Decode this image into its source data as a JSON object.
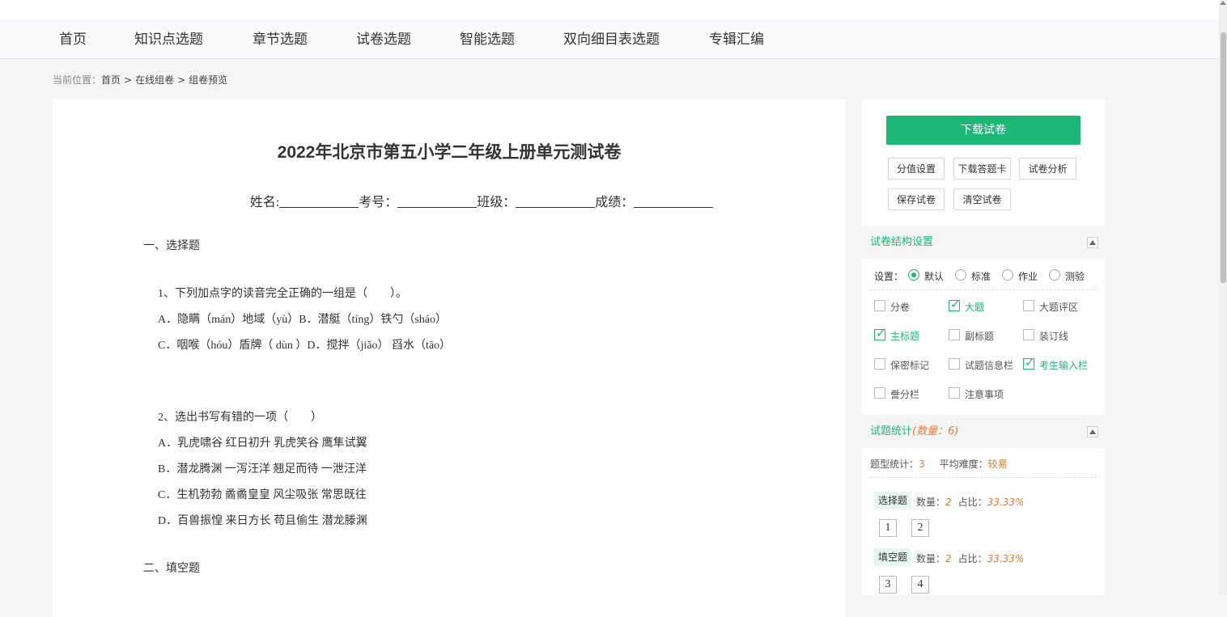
{
  "nav": [
    "首页",
    "知识点选题",
    "章节选题",
    "试卷选题",
    "智能选题",
    "双向细目表选题",
    "专辑汇编"
  ],
  "breadcrumb": {
    "prefix": "当前位置：",
    "items": [
      "首页",
      "在线组卷",
      "组卷预览"
    ],
    "sep": ">"
  },
  "paper": {
    "title": "2022年北京市第五小学二年级上册单元测试卷",
    "info_labels": [
      "姓名:",
      "考号：",
      "班级：",
      "成绩："
    ],
    "section1": "一、选择题",
    "q1": {
      "stem": "1、下列加点字的读音完全正确的一组是（　　）。",
      "lines": [
        "A．隐瞒（mán）地域（yù）B．潜艇（tíng）铁勺（sháo）",
        "C．咽喉（hóu）盾牌（ dùn ）D．搅拌（jiǎo） 舀水（tāo）"
      ]
    },
    "q2": {
      "stem": "2、选出书写有错的一项（　　）",
      "lines": [
        "A．乳虎啸谷  红日初升  乳虎笑谷  鹰隼试翼",
        "B．潜龙腾渊  一泻汪洋  翘足而待  一泄汪洋",
        "C．生机勃勃  矞矞皇皇  风尘吸张  常思既往",
        "D．百兽振惶  来日方长  苟且偷生  潜龙滕渊"
      ]
    },
    "section2": "二、填空题"
  },
  "side": {
    "download": "下载试卷",
    "buttons": [
      "分值设置",
      "下载答题卡",
      "试卷分析",
      "保存试卷",
      "清空试卷"
    ],
    "structure": {
      "title": "试卷结构设置",
      "setting_label": "设置：",
      "radios": [
        {
          "label": "默认",
          "checked": true
        },
        {
          "label": "标准",
          "checked": false
        },
        {
          "label": "作业",
          "checked": false
        },
        {
          "label": "测验",
          "checked": false
        }
      ],
      "checkboxes": [
        {
          "label": "分卷",
          "checked": false
        },
        {
          "label": "大题",
          "checked": true
        },
        {
          "label": "大题评区",
          "checked": false
        },
        {
          "label": "主标题",
          "checked": true
        },
        {
          "label": "副标题",
          "checked": false
        },
        {
          "label": "装订线",
          "checked": false
        },
        {
          "label": "保密标记",
          "checked": false
        },
        {
          "label": "试题信息栏",
          "checked": false
        },
        {
          "label": "考生输入栏",
          "checked": true
        },
        {
          "label": "誊分栏",
          "checked": false
        },
        {
          "label": "注意事项",
          "checked": false
        }
      ]
    },
    "stats": {
      "title": "试题统计",
      "count_text": "(数量：6)",
      "type_count_label": "题型统计：",
      "type_count": "3",
      "difficulty_label": "平均难度：",
      "difficulty": "较易",
      "groups": [
        {
          "name": "选择题",
          "count_label": "数量：",
          "count": "2",
          "ratio_label": "占比：",
          "ratio": "33.33%",
          "items": [
            "1",
            "2"
          ]
        },
        {
          "name": "填空题",
          "count_label": "数量：",
          "count": "2",
          "ratio_label": "占比：",
          "ratio": "33.33%",
          "items": [
            "3",
            "4"
          ]
        }
      ]
    }
  },
  "colors": {
    "accent": "#1db777",
    "highlight": "#e07b3c"
  }
}
